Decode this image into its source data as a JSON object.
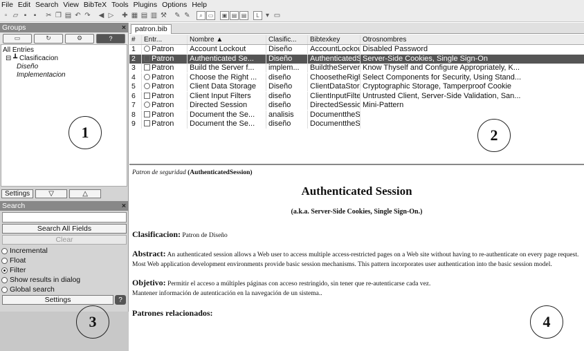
{
  "menu": [
    "File",
    "Edit",
    "Search",
    "View",
    "BibTeX",
    "Tools",
    "Plugins",
    "Options",
    "Help"
  ],
  "groups_panel": {
    "title": "Groups",
    "close": "×",
    "tree": {
      "all": "All Entries",
      "root": "Clasificacion",
      "children": [
        "Diseño",
        "Implementacion"
      ]
    },
    "settings_label": "Settings"
  },
  "search_panel": {
    "title": "Search",
    "close": "×",
    "query": "",
    "search_all_label": "Search All Fields",
    "clear_label": "Clear",
    "options": [
      {
        "label": "Incremental",
        "selected": false
      },
      {
        "label": "Float",
        "selected": false
      },
      {
        "label": "Filter",
        "selected": true
      },
      {
        "label": "Show results in dialog",
        "selected": false
      },
      {
        "label": "Global search",
        "selected": false
      }
    ],
    "settings_label": "Settings"
  },
  "tab": "patron.bib",
  "table": {
    "columns": [
      "#",
      "Entr...",
      "Nombre ▲",
      "Clasific...",
      "Bibtexkey",
      "Otrosnombres"
    ],
    "selected_row": 1,
    "rows": [
      {
        "n": "1",
        "type": "Patron",
        "nombre": "Account Lockout",
        "clasif": "Diseño",
        "key": "AccountLockout",
        "otros": "Disabled Password"
      },
      {
        "n": "2",
        "type": "Patron",
        "nombre": "Authenticated Se...",
        "clasif": "Diseño",
        "key": "AuthenticatedSe...",
        "otros": "Server-Side Cookies, Single Sign-On"
      },
      {
        "n": "3",
        "type": "Patron",
        "nombre": "Build the Server f...",
        "clasif": "implem...",
        "key": "BuildtheServerfr...",
        "otros": "Know Thyself and Configure Appropriately, K..."
      },
      {
        "n": "4",
        "type": "Patron",
        "nombre": "Choose the Right ...",
        "clasif": "diseño",
        "key": "ChoosetheRight...",
        "otros": "Select Components for Security, Using Stand..."
      },
      {
        "n": "5",
        "type": "Patron",
        "nombre": "Client Data Storage",
        "clasif": "Diseño",
        "key": "ClientDataStorage",
        "otros": "Cryptographic Storage, Tamperproof Cookie"
      },
      {
        "n": "6",
        "type": "Patron",
        "nombre": "Client Input Filters",
        "clasif": "diseño",
        "key": "ClientInputFilters",
        "otros": "Untrusted Client, Server-Side Validation, San..."
      },
      {
        "n": "7",
        "type": "Patron",
        "nombre": "Directed Session",
        "clasif": "diseño",
        "key": "DirectedSession",
        "otros": "Mini-Pattern"
      },
      {
        "n": "8",
        "type": "Patron",
        "nombre": "Document the Se...",
        "clasif": "analisis",
        "key": "DocumenttheSec...",
        "otros": ""
      },
      {
        "n": "9",
        "type": "Patron",
        "nombre": "Document the Se...",
        "clasif": "diseño",
        "key": "DocumenttheSer...",
        "otros": ""
      }
    ]
  },
  "preview": {
    "header_italic": "Patron de seguridad",
    "header_key": "(AuthenticatedSession)",
    "title": "Authenticated Session",
    "aka": "(a.k.a. Server-Side Cookies, Single Sign-On.)",
    "clasificacion_label": "Clasificacion:",
    "clasificacion_value": "Patron de Diseño",
    "abstract_label": "Abstract:",
    "abstract_text": "An authenticated session allows a Web user to access multiple access-restricted pages on a Web site without having to re-authenticate on every page request. Most Web application development environments provide basic session mechanisms. This pattern incorporates user authentication into the basic session model.",
    "objetivo_label": "Objetivo:",
    "objetivo_text": "Permitir el acceso a múltiples páginas con acceso restringido, sin tener que re-autenticarse cada vez.",
    "objetivo_text2": "Mantener información de autenticación en la navegación de un sistema..",
    "related_label": "Patrones relacionados:"
  },
  "markers": [
    "1",
    "2",
    "3",
    "4"
  ]
}
